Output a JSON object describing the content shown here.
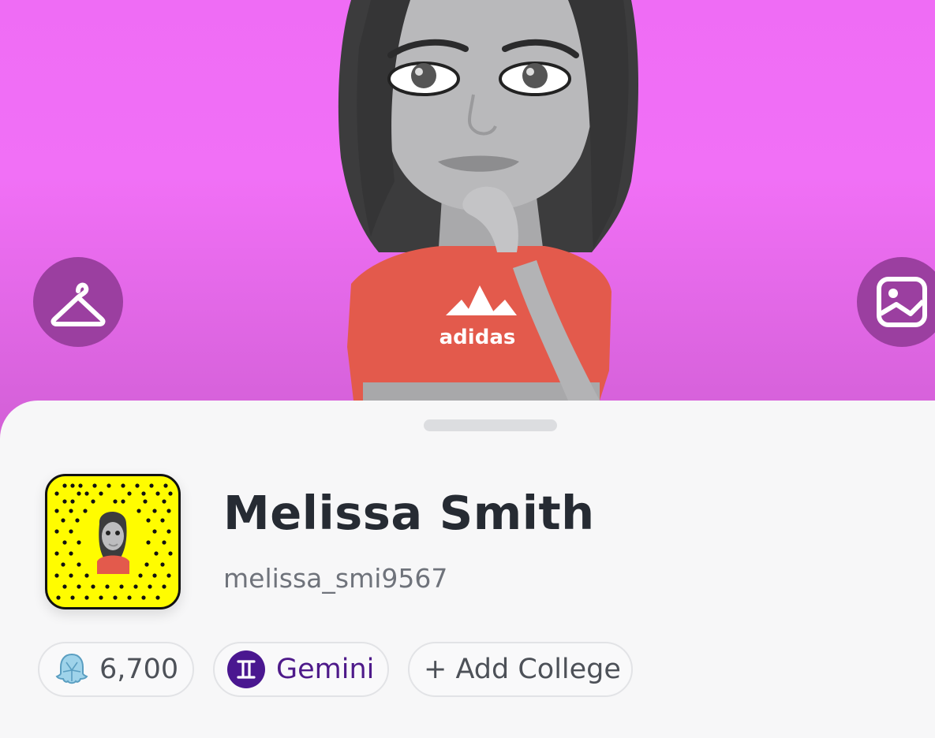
{
  "hero": {
    "avatar_shirt_text": "adidas",
    "buttons": {
      "outfit_icon": "hanger-icon",
      "photo_icon": "image-icon"
    }
  },
  "profile": {
    "display_name": "Melissa Smith",
    "username": "melissa_smi9567"
  },
  "pills": {
    "score": "6,700",
    "score_icon": "crystal-ghost-icon",
    "zodiac": "Gemini",
    "zodiac_icon": "gemini-icon",
    "college": "+ Add College"
  },
  "colors": {
    "hero_bg": "#f170f6",
    "button_bg": "#9b3fa0",
    "snapcode_yellow": "#fffc00",
    "zodiac_purple": "#4a1790"
  }
}
